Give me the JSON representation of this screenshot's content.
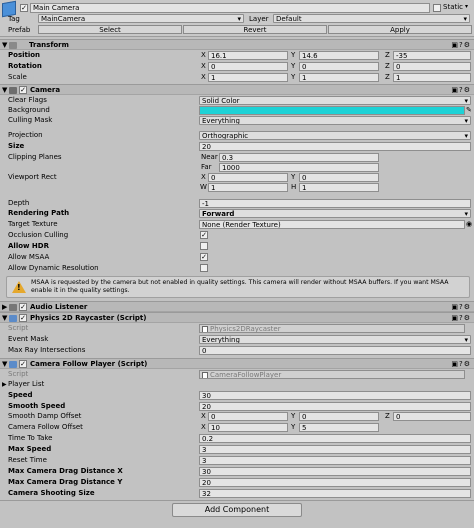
{
  "header": {
    "object_name": "Main Camera",
    "static_label": "Static",
    "tag_label": "Tag",
    "tag_value": "MainCamera",
    "layer_label": "Layer",
    "layer_value": "Default",
    "prefab_label": "Prefab",
    "select_label": "Select",
    "revert_label": "Revert",
    "apply_label": "Apply"
  },
  "transform": {
    "title": "Transform",
    "position_label": "Position",
    "rotation_label": "Rotation",
    "scale_label": "Scale",
    "axis_x": "X",
    "axis_y": "Y",
    "axis_z": "Z",
    "position": [
      "16.1",
      "14.6",
      "-35"
    ],
    "rotation": [
      "0",
      "0",
      "0"
    ],
    "scale": [
      "1",
      "1",
      "1"
    ]
  },
  "camera": {
    "title": "Camera",
    "clear_flags_label": "Clear Flags",
    "clear_flags_value": "Solid Color",
    "background_label": "Background",
    "background_color": "#1ed2d6",
    "culling_mask_label": "Culling Mask",
    "culling_mask_value": "Everything",
    "projection_label": "Projection",
    "projection_value": "Orthographic",
    "size_label": "Size",
    "size_value": "20",
    "clipping_label": "Clipping Planes",
    "near_label": "Near",
    "near_value": "0.3",
    "far_label": "Far",
    "far_value": "1000",
    "viewport_label": "Viewport Rect",
    "vp_x_label": "X",
    "vp_x": "0",
    "vp_y_label": "Y",
    "vp_y": "0",
    "vp_w_label": "W",
    "vp_w": "1",
    "vp_h_label": "H",
    "vp_h": "1",
    "depth_label": "Depth",
    "depth_value": "-1",
    "rendering_path_label": "Rendering Path",
    "rendering_path_value": "Forward",
    "target_texture_label": "Target Texture",
    "target_texture_value": "None (Render Texture)",
    "occlusion_label": "Occlusion Culling",
    "occlusion_check": "✓",
    "hdr_label": "Allow HDR",
    "msaa_label": "Allow MSAA",
    "msaa_check": "✓",
    "dynres_label": "Allow Dynamic Resolution",
    "warning": "MSAA is requested by the camera but not enabled in quality settings. This camera will render without MSAA buffers. If you want MSAA enable it in the quality settings."
  },
  "audio_listener": {
    "title": "Audio Listener",
    "check": "✓"
  },
  "raycaster": {
    "title": "Physics 2D Raycaster (Script)",
    "check": "✓",
    "script_label": "Script",
    "script_value": "Physics2DRaycaster",
    "event_mask_label": "Event Mask",
    "event_mask_value": "Everything",
    "max_ray_label": "Max Ray Intersections",
    "max_ray_value": "0"
  },
  "follow": {
    "title": "Camera Follow Player (Script)",
    "check": "✓",
    "script_label": "Script",
    "script_value": "CameraFollowPlayer",
    "player_list_label": "Player List",
    "speed_label": "Speed",
    "speed_value": "30",
    "smooth_speed_label": "Smooth Speed",
    "smooth_speed_value": "20",
    "smooth_damp_label": "Smooth Damp Offset",
    "sd_x_label": "X",
    "sd_x": "0",
    "sd_y_label": "Y",
    "sd_y": "0",
    "sd_z_label": "Z",
    "sd_z": "0",
    "follow_offset_label": "Camera Follow Offset",
    "fo_x_label": "X",
    "fo_x": "10",
    "fo_y_label": "Y",
    "fo_y": "5",
    "time_label": "Time To Take",
    "time_value": "0.2",
    "max_speed_label": "Max Speed",
    "max_speed_value": "3",
    "reset_label": "Reset Time",
    "reset_value": "3",
    "drag_x_label": "Max Camera Drag Distance X",
    "drag_x_value": "30",
    "drag_y_label": "Max Camera Drag Distance Y",
    "drag_y_value": "20",
    "shoot_label": "Camera Shooting Size",
    "shoot_value": "32"
  },
  "add_component_label": "Add Component",
  "colors": {
    "panel": "#c2c2c2",
    "header": "#b8b8b8",
    "accent_blue": "#3a7bd5"
  }
}
